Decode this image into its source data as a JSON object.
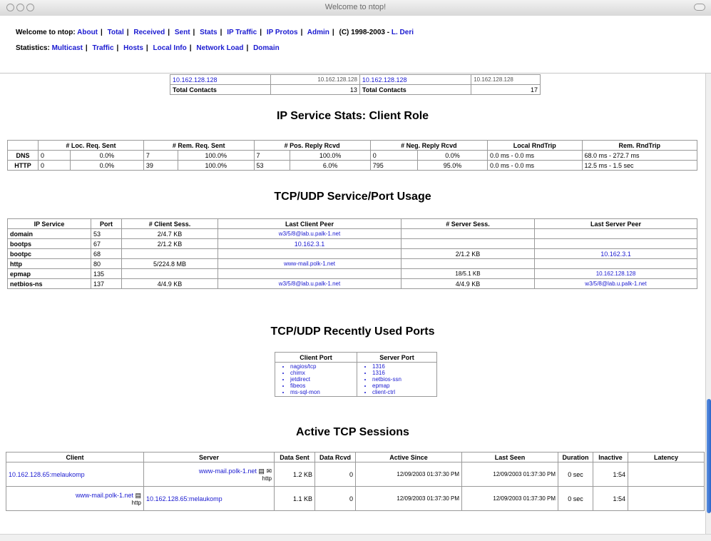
{
  "window": {
    "title": "Welcome to ntop!"
  },
  "nav": {
    "prefix": "Welcome to ntop:",
    "links": [
      "About",
      "Total",
      "Received",
      "Sent",
      "Stats",
      "IP Traffic",
      "IP Protos",
      "Admin"
    ],
    "copyright": "(C) 1998-2003 -",
    "author": "L. Deri",
    "stats_prefix": "Statistics:",
    "stats_links": [
      "Multicast",
      "Traffic",
      "Hosts",
      "Local Info",
      "Network Load",
      "Domain"
    ]
  },
  "contacts": {
    "row1": [
      "10.162.128.128",
      "10.162.128.128",
      "10.162.128.128",
      "10.162.128.128"
    ],
    "label": "Total Contacts",
    "left_value": "13",
    "right_value": "17"
  },
  "svc_stats": {
    "title": "IP Service Stats: Client Role",
    "headers": [
      "# Loc. Req. Sent",
      "# Rem. Req. Sent",
      "# Pos. Reply Rcvd",
      "# Neg. Reply Rcvd",
      "Local RndTrip",
      "Rem. RndTrip"
    ],
    "rows": [
      {
        "name": "DNS",
        "cells": [
          "0",
          "0.0%",
          "7",
          "100.0%",
          "7",
          "100.0%",
          "0",
          "0.0%",
          "0.0 ms - 0.0 ms",
          "68.0 ms - 272.7 ms"
        ]
      },
      {
        "name": "HTTP",
        "cells": [
          "0",
          "0.0%",
          "39",
          "100.0%",
          "53",
          "6.0%",
          "795",
          "95.0%",
          "0.0 ms - 0.0 ms",
          "12.5 ms - 1.5 sec"
        ]
      }
    ]
  },
  "port_usage": {
    "title": "TCP/UDP Service/Port Usage",
    "headers": [
      "IP Service",
      "Port",
      "# Client Sess.",
      "Last Client Peer",
      "# Server Sess.",
      "Last Server Peer"
    ],
    "rows": [
      {
        "svc": "domain",
        "port": "53",
        "cs": "2/4.7 KB",
        "cp": "w3/5/8@lab.u.palk-1.net",
        "ss": "",
        "sp": ""
      },
      {
        "svc": "bootps",
        "port": "67",
        "cs": "2/1.2 KB",
        "cp": "10.162.3.1",
        "ss": "",
        "sp": ""
      },
      {
        "svc": "bootpc",
        "port": "68",
        "cs": "",
        "cp": "",
        "ss": "2/1.2 KB",
        "sp": "10.162.3.1"
      },
      {
        "svc": "http",
        "port": "80",
        "cs": "5/224.8 MB",
        "cp": "www-mail.polk-1.net",
        "ss": "",
        "sp": ""
      },
      {
        "svc": "epmap",
        "port": "135",
        "cs": "",
        "cp": "",
        "ss": "18/5.1 KB",
        "sp": "10.162.128.128"
      },
      {
        "svc": "netbios-ns",
        "port": "137",
        "cs": "4/4.9 KB",
        "cp": "w3/5/8@lab.u.palk-1.net",
        "ss": "4/4.9 KB",
        "sp": "w3/5/8@lab.u.palk-1.net"
      }
    ]
  },
  "recent_ports": {
    "title": "TCP/UDP Recently Used Ports",
    "client_header": "Client Port",
    "server_header": "Server Port",
    "client": [
      "nagios/tcp",
      "chimx",
      "jetdirect",
      "fibeos",
      "ms-sql-mon"
    ],
    "server": [
      "1316",
      "1316",
      "netbios-ssn",
      "epmap",
      "client-ctrl"
    ]
  },
  "sessions": {
    "title": "Active TCP Sessions",
    "headers": [
      "Client",
      "Server",
      "Data Sent",
      "Data Rcvd",
      "Active Since",
      "Last Seen",
      "Duration",
      "Inactive",
      "Latency"
    ],
    "rows": [
      {
        "client": "10.162.128.65:melaukomp",
        "server": "www-mail.polk-1.net",
        "server_tag": "http",
        "sent": "1.2 KB",
        "rcvd": "0",
        "since": "12/09/2003 01:37:30 PM",
        "seen": "12/09/2003 01:37:30 PM",
        "dur": "0 sec",
        "inact": "1:54",
        "lat": ""
      },
      {
        "client": "www-mail.polk-1.net",
        "client_tag": "http",
        "server": "10.162.128.65:melaukomp",
        "sent": "1.1 KB",
        "rcvd": "0",
        "since": "12/09/2003 01:37:30 PM",
        "seen": "12/09/2003 01:37:30 PM",
        "dur": "0 sec",
        "inact": "1:54",
        "lat": ""
      }
    ]
  },
  "status_bar": {
    "text": ""
  }
}
